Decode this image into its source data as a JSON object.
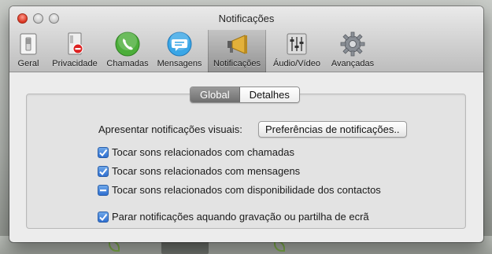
{
  "window": {
    "title": "Notificações"
  },
  "toolbar": {
    "items": [
      {
        "label": "Geral",
        "icon": "switch-icon"
      },
      {
        "label": "Privacidade",
        "icon": "privacy-icon"
      },
      {
        "label": "Chamadas",
        "icon": "phone-icon"
      },
      {
        "label": "Mensagens",
        "icon": "message-icon"
      },
      {
        "label": "Notificações",
        "icon": "megaphone-icon",
        "active": true
      },
      {
        "label": "Áudio/Vídeo",
        "icon": "mixer-icon"
      },
      {
        "label": "Avançadas",
        "icon": "gear-icon"
      }
    ]
  },
  "tabs": {
    "global": "Global",
    "details": "Detalhes",
    "selected": "Global"
  },
  "visual": {
    "label": "Apresentar notificações visuais:",
    "button": "Preferências de notificações.."
  },
  "options": [
    {
      "label": "Tocar sons relacionados com chamadas",
      "state": "checked"
    },
    {
      "label": "Tocar sons relacionados com mensagens",
      "state": "checked"
    },
    {
      "label": "Tocar sons relacionados com disponibilidade dos contactos",
      "state": "mixed"
    },
    {
      "label": "Parar notificações aquando gravação ou partilha de ecrã",
      "state": "checked"
    }
  ],
  "colors": {
    "accent": "#2f6fd0",
    "close": "#d9321f"
  }
}
